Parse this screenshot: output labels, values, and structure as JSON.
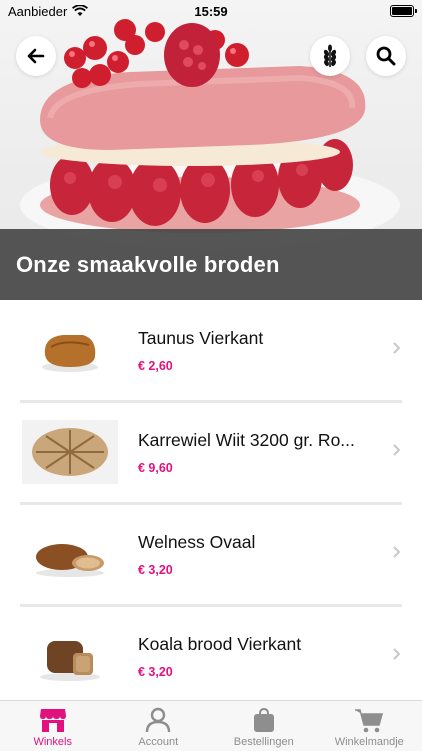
{
  "status_bar": {
    "carrier": "Aanbieder",
    "time": "15:59"
  },
  "hero": {
    "title": "Onze smaakvolle broden"
  },
  "header_buttons": {
    "back": "arrow-left-icon",
    "filter": "wheat-icon",
    "search": "search-icon"
  },
  "products": [
    {
      "name": "Taunus Vierkant",
      "price": "€ 2,60"
    },
    {
      "name": "Karrewiel Wiit 3200 gr. Ro...",
      "price": "€ 9,60"
    },
    {
      "name": "Welness Ovaal",
      "price": "€ 3,20"
    },
    {
      "name": "Koala brood Vierkant",
      "price": "€ 3,20"
    }
  ],
  "tabs": [
    {
      "label": "Winkels",
      "icon": "shop-icon",
      "active": true
    },
    {
      "label": "Account",
      "icon": "user-icon",
      "active": false
    },
    {
      "label": "Bestellingen",
      "icon": "bag-icon",
      "active": false
    },
    {
      "label": "Winkelmandje",
      "icon": "cart-icon",
      "active": false
    }
  ],
  "colors": {
    "accent": "#e3117e",
    "overlay": "#464646",
    "tab_inactive": "#8e8e8e"
  }
}
